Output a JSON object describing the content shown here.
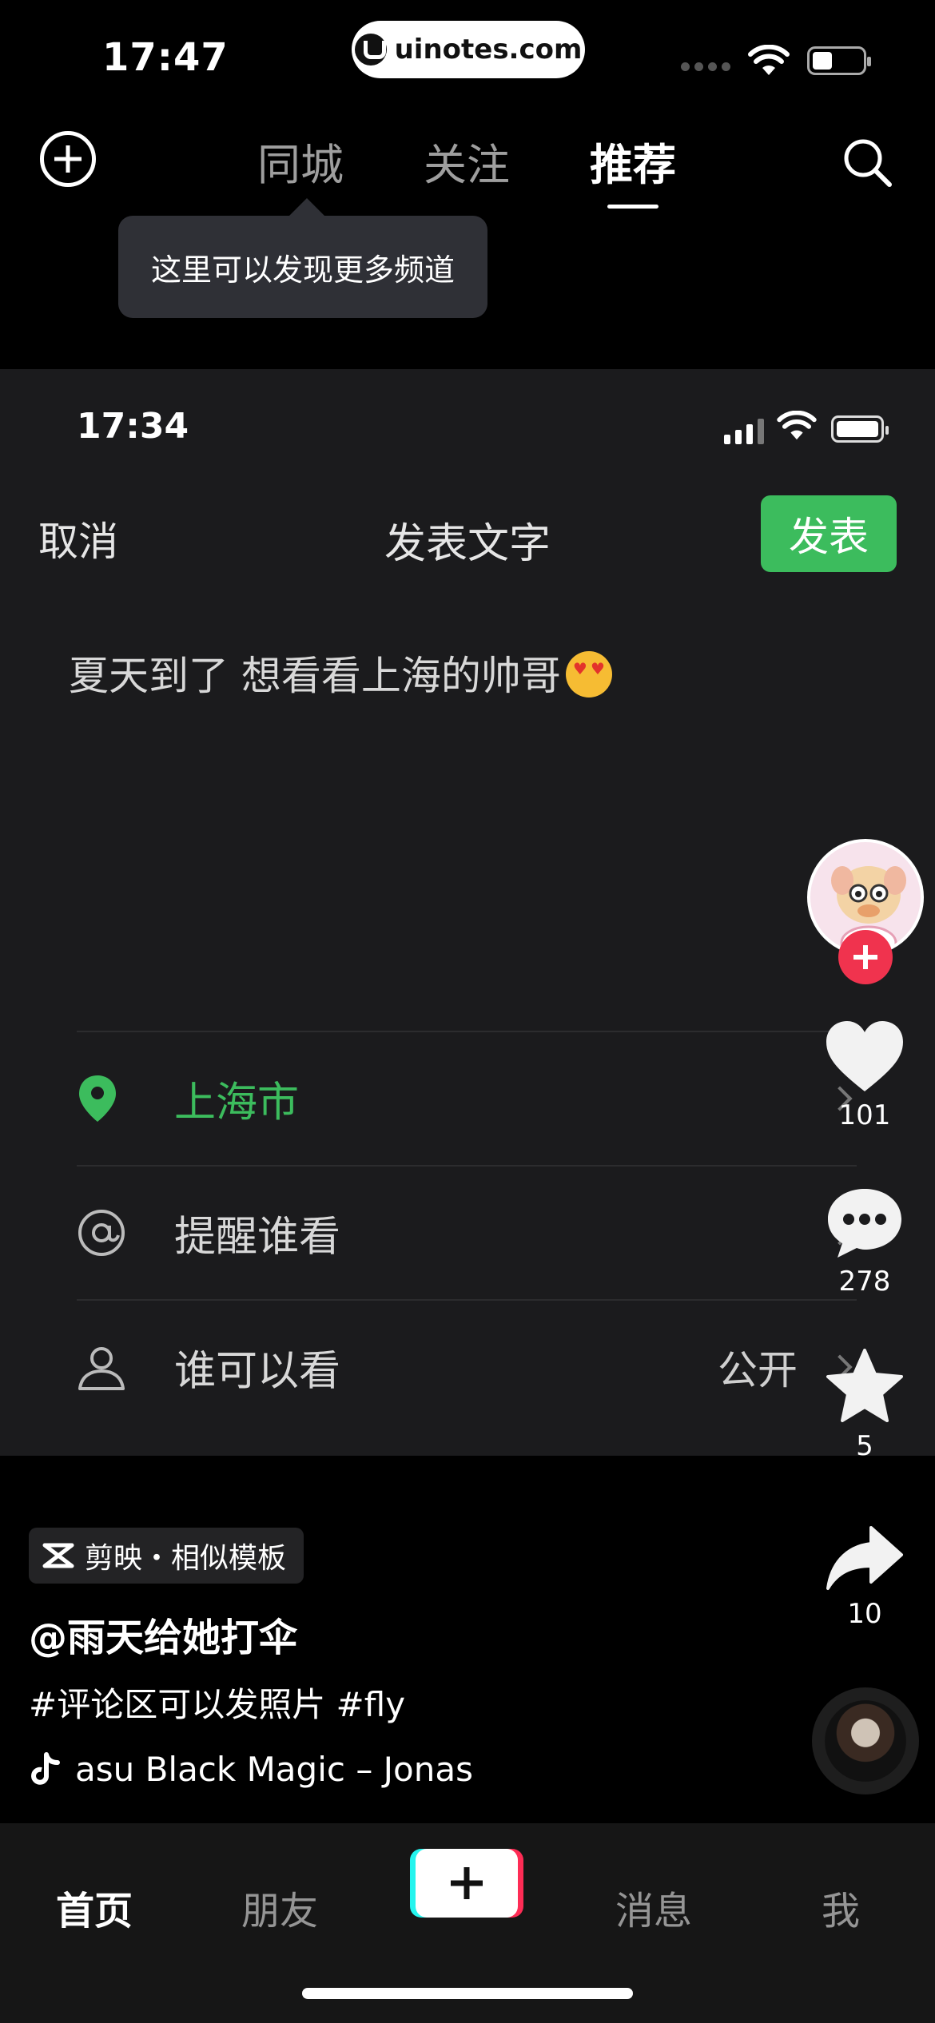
{
  "status_bar": {
    "time": "17:47",
    "url": "uinotes.com"
  },
  "top_nav": {
    "tabs": [
      {
        "label": "同城"
      },
      {
        "label": "关注"
      },
      {
        "label": "推荐"
      }
    ],
    "active_tab": "推荐",
    "tooltip": "这里可以发现更多频道"
  },
  "video_frame": {
    "status_time": "17:34",
    "cancel_label": "取消",
    "title": "发表文字",
    "publish_label": "发表",
    "post_text": "夏天到了  想看看上海的帅哥",
    "post_emoji": "heart-eyes-emoji",
    "rows": [
      {
        "icon": "location-pin-icon",
        "label": "上海市",
        "value": ""
      },
      {
        "icon": "at-sign-icon",
        "label": "提醒谁看",
        "value": ""
      },
      {
        "icon": "person-icon",
        "label": "谁可以看",
        "value": "公开"
      }
    ],
    "accent_color": "#3cbc5d"
  },
  "actions": {
    "likes": "101",
    "comments": "278",
    "favorites": "5",
    "shares": "10"
  },
  "info": {
    "template_chip": "剪映・相似模板",
    "author": "@雨天给她打伞",
    "description": "#评论区可以发照片 #fly",
    "music": "asu    Black Magic – Jonas"
  },
  "bottom_bar": {
    "tabs": [
      "首页",
      "朋友",
      "消息",
      "我"
    ],
    "active_tab": "首页"
  },
  "colors": {
    "follow_red": "#f0334e",
    "create_cyan": "#25f4ee",
    "create_pink": "#fe2c55"
  }
}
